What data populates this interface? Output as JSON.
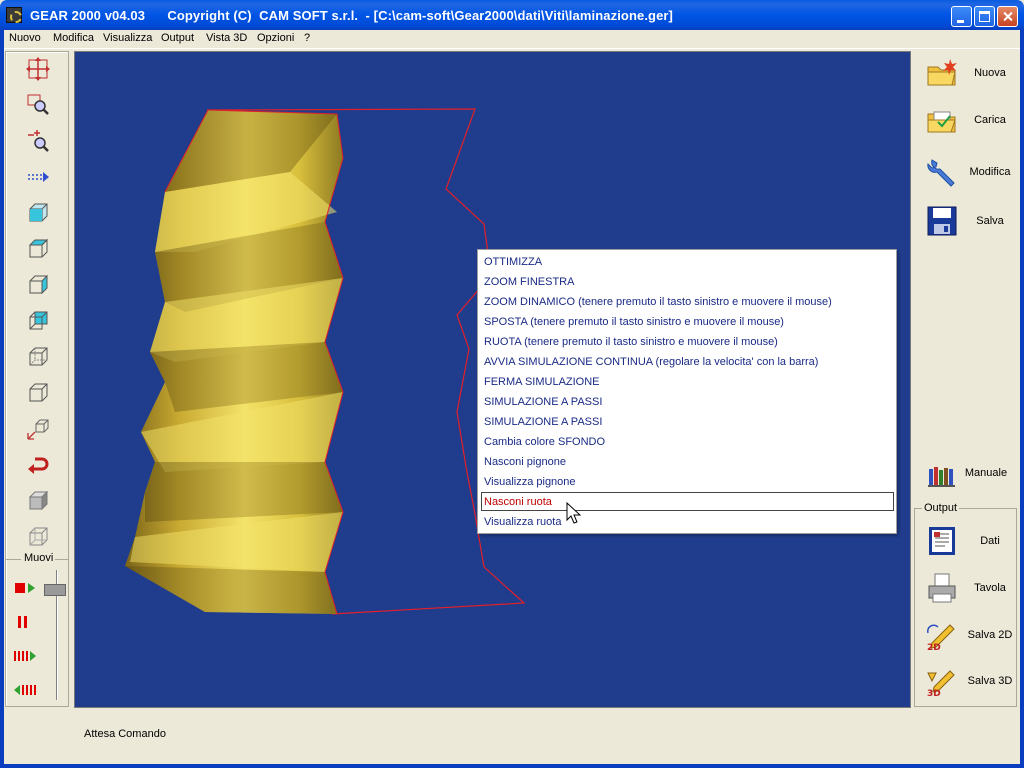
{
  "window": {
    "title": "GEAR 2000 v04.03      Copyright (C)  CAM SOFT s.r.l.  - [C:\\cam-soft\\Gear2000\\dati\\Viti\\laminazione.ger]"
  },
  "menu": [
    "Nuovo",
    "Modifica",
    "Visualizza",
    "Output",
    "Vista 3D",
    "Opzioni",
    "?"
  ],
  "left_toolbar": {
    "tools": [
      "pan-move-icon",
      "zoom-window-icon",
      "zoom-dynamic-icon",
      "arrow-right-icon",
      "cube-front-icon",
      "cube-top-icon",
      "cube-side-icon",
      "cube-iso-icon",
      "cube-wire-icon",
      "cube-wire2-icon",
      "rotate-axes-icon",
      "undo-arrow-icon",
      "cube-solid-icon",
      "cube-hidden-icon"
    ],
    "muovi_label": "Muovi"
  },
  "context_menu": {
    "items": [
      "OTTIMIZZA",
      "ZOOM FINESTRA",
      "ZOOM DINAMICO (tenere premuto il tasto sinistro e muovere il mouse)",
      "SPOSTA (tenere premuto il tasto sinistro e muovere il mouse)",
      "RUOTA (tenere premuto il tasto sinistro e muovere il mouse)",
      "AVVIA SIMULAZIONE CONTINUA (regolare la velocita' con la barra)",
      "FERMA SIMULAZIONE",
      "SIMULAZIONE A PASSI",
      "SIMULAZIONE A PASSI",
      "Cambia colore SFONDO",
      "Nasconi pignone",
      "Visualizza pignone",
      "Nasconi ruota",
      "Visualizza ruota"
    ],
    "selected_index": 12
  },
  "right_panel": {
    "nuova": "Nuova",
    "carica": "Carica",
    "modifica": "Modifica",
    "salva": "Salva",
    "manuale": "Manuale",
    "output_label": "Output",
    "dati": "Dati",
    "tavola": "Tavola",
    "salva2d": "Salva 2D",
    "salva3d": "Salva 3D"
  },
  "status": {
    "text": "Attesa Comando"
  },
  "colors": {
    "canvas_bg": "#203c8c",
    "screw": "#d8c040",
    "outline": "#e0202a",
    "menu_text": "#1a2a86",
    "selected_text": "#c00000"
  }
}
